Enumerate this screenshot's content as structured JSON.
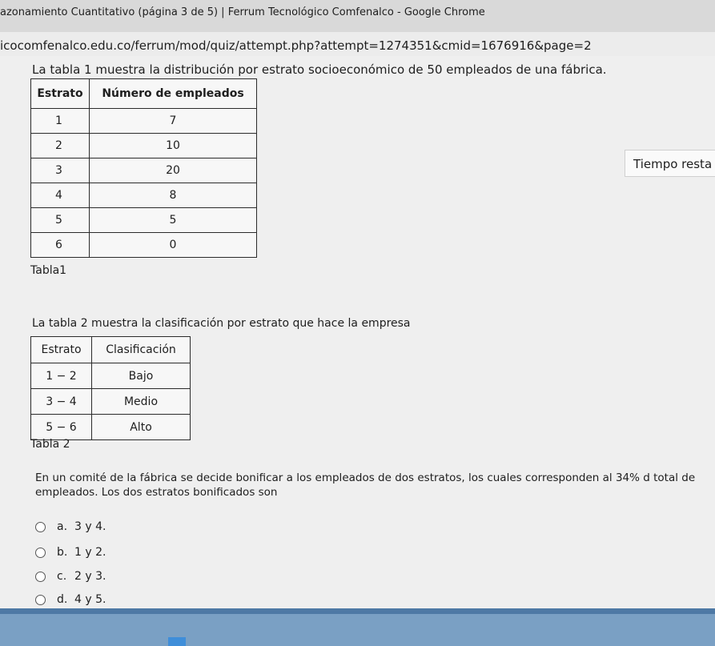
{
  "window": {
    "title": "azonamiento Cuantitativo (página 3 de 5) | Ferrum Tecnológico Comfenalco - Google Chrome"
  },
  "address_bar": {
    "url": "icocomfenalco.edu.co/ferrum/mod/quiz/attempt.php?attempt=1274351&cmid=1676916&page=2"
  },
  "timer": {
    "label": "Tiempo resta"
  },
  "question": {
    "intro1": "La tabla 1 muestra la distribución por estrato socioeconómico de 50 empleados de una fábrica.",
    "table1": {
      "headers": [
        "Estrato",
        "Número de empleados"
      ],
      "rows": [
        [
          "1",
          "7"
        ],
        [
          "2",
          "10"
        ],
        [
          "3",
          "20"
        ],
        [
          "4",
          "8"
        ],
        [
          "5",
          "5"
        ],
        [
          "6",
          "0"
        ]
      ],
      "caption": "Tabla1"
    },
    "intro2": "La tabla 2 muestra la clasificación por estrato que hace la empresa",
    "table2": {
      "headers": [
        "Estrato",
        "Clasificación"
      ],
      "rows": [
        [
          "1 − 2",
          "Bajo"
        ],
        [
          "3 − 4",
          "Medio"
        ],
        [
          "5 − 6",
          "Alto"
        ]
      ],
      "caption": "Tabla 2"
    },
    "prompt": "En un comité de la fábrica se decide bonificar a los empleados de dos estratos, los cuales corresponden al 34% d total de empleados. Los dos estratos bonificados son",
    "options": [
      {
        "letter": "a.",
        "text": "3 y 4."
      },
      {
        "letter": "b.",
        "text": "1 y 2."
      },
      {
        "letter": "c.",
        "text": "2 y 3."
      },
      {
        "letter": "d.",
        "text": "4 y 5."
      }
    ]
  }
}
